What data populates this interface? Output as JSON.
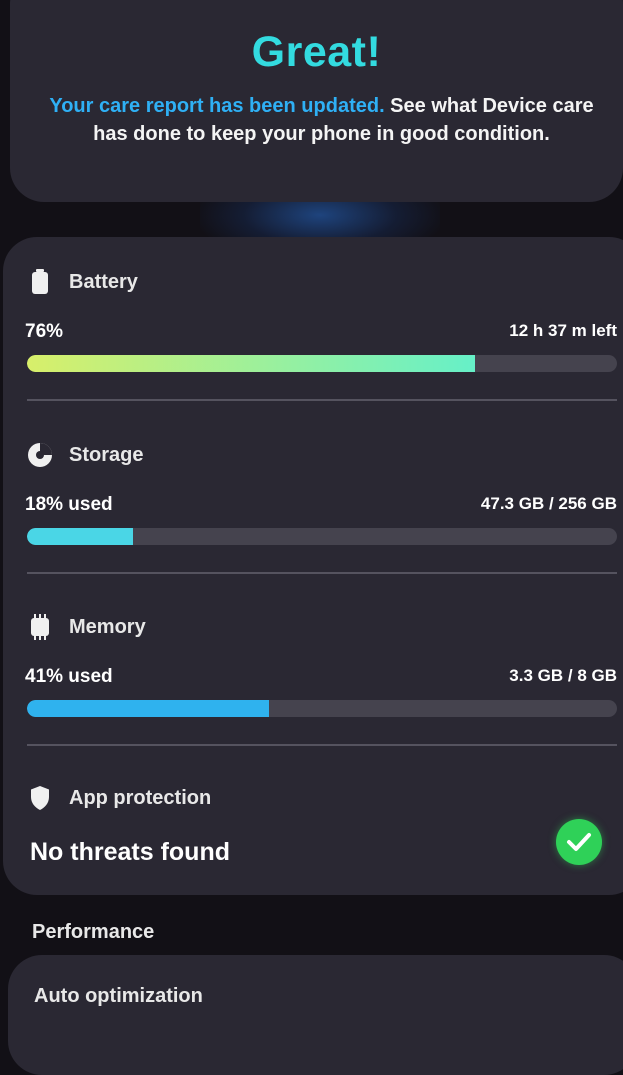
{
  "header": {
    "title": "Great!",
    "desc_highlight": "Your care report has been updated.",
    "desc_rest": " See what Device care has done to keep your phone in good condition."
  },
  "battery": {
    "title": "Battery",
    "left_text": "76%",
    "right_text": "12 h 37 m left",
    "percent": 76,
    "color_start": "#d8ef6a",
    "color_end": "#66f0c8",
    "icon": "battery-icon"
  },
  "storage": {
    "title": "Storage",
    "left_text": "18% used",
    "right_text": "47.3 GB / 256 GB",
    "percent": 18,
    "color": "#4ad6e6",
    "icon": "storage-pie-icon"
  },
  "memory": {
    "title": "Memory",
    "left_text": "41% used",
    "right_text": "3.3 GB / 8 GB",
    "percent": 41,
    "color": "#2fb2ee",
    "icon": "memory-chip-icon"
  },
  "app_protection": {
    "title": "App protection",
    "status": "No threats found",
    "status_color": "#2fd158",
    "icon": "shield-icon",
    "status_icon": "check-circle-icon"
  },
  "performance": {
    "label": "Performance",
    "auto_optimization": "Auto optimization"
  }
}
